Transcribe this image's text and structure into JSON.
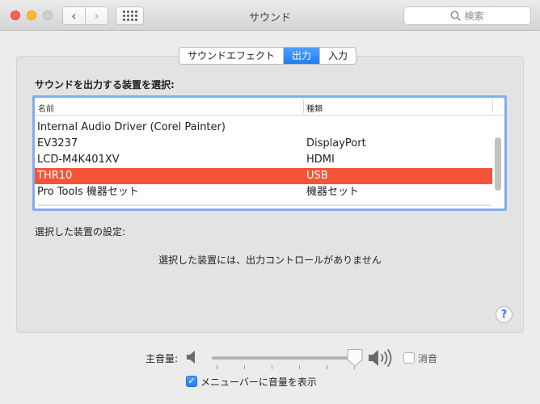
{
  "window": {
    "title": "サウンド",
    "search_placeholder": "検索",
    "back_glyph": "‹",
    "forward_glyph": "›"
  },
  "tabs": [
    {
      "label": "サウンドエフェクト",
      "active": false
    },
    {
      "label": "出力",
      "active": true
    },
    {
      "label": "入力",
      "active": false
    }
  ],
  "output": {
    "section_label": "サウンドを出力する装置を選択:",
    "columns": {
      "name": "名前",
      "type": "種類"
    },
    "devices": [
      {
        "name": "Internal Audio Driver (Corel Painter)",
        "type": "",
        "selected": false
      },
      {
        "name": "EV3237",
        "type": "DisplayPort",
        "selected": false
      },
      {
        "name": "LCD-M4K401XV",
        "type": "HDMI",
        "selected": false
      },
      {
        "name": "THR10",
        "type": "USB",
        "selected": true
      },
      {
        "name": "Pro Tools 機器セット",
        "type": "機器セット",
        "selected": false
      }
    ],
    "settings_label": "選択した装置の設定:",
    "no_controls_message": "選択した装置には、出力コントロールがありません"
  },
  "help_glyph": "?",
  "volume": {
    "label": "主音量:",
    "level": 0.98,
    "mute_label": "消音",
    "muted": false
  },
  "menubar": {
    "label": "メニューバーに音量を表示",
    "checked": true,
    "check_glyph": "✓"
  },
  "colors": {
    "selection": "#f45438",
    "accent": "#1f7ef2"
  }
}
